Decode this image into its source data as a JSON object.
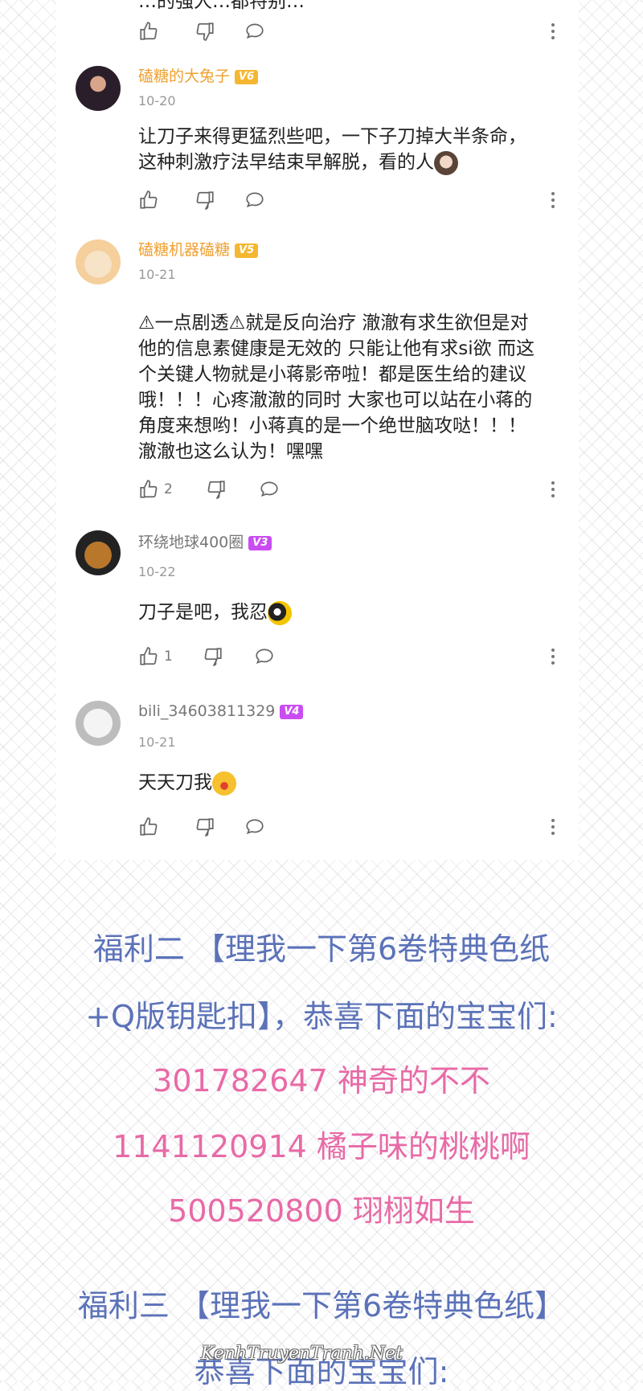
{
  "partial_top_text": "…的强人…都特别…",
  "comments": [
    {
      "username": "磕糖的大兔子",
      "level": "V6",
      "date": "10-20",
      "text": "让刀子来得更猛烈些吧，一下子刀掉大半条命，这种刺激疗法早结束早解脱，看的人",
      "likes": ""
    },
    {
      "username": "磕糖机器磕糖",
      "level": "V5",
      "date": "10-21",
      "text": "⚠一点剧透⚠就是反向治疗 澈澈有求生欲但是对他的信息素健康是无效的 只能让他有求si欲 而这个关键人物就是小蒋影帝啦！都是医生给的建议哦！！！心疼澈澈的同时 大家也可以站在小蒋的角度来想哟！小蒋真的是一个绝世脑攻哒！！！澈澈也这么认为！嘿嘿",
      "likes": "2"
    },
    {
      "username": "环绕地球400圈",
      "level": "V3",
      "date": "10-22",
      "text": "刀子是吧，我忍",
      "likes": "1"
    },
    {
      "username": "bili_34603811329",
      "level": "V4",
      "date": "10-21",
      "text": "天天刀我",
      "likes": ""
    }
  ],
  "colors": {
    "badge_orange": "#f5b732",
    "badge_purple": "#c94df2",
    "blue_text": "#5b72b8",
    "pink_text": "#e86aa6"
  },
  "announcement": {
    "line1": "福利二 【理我一下第6卷特典色纸",
    "line2": "+Q版钥匙扣】，恭喜下面的宝宝们:",
    "winners": [
      "301782647   神奇的不不",
      "1141120914  橘子味的桃桃啊",
      "500520800   珝栩如生"
    ],
    "line3": "福利三 【理我一下第6卷特典色纸】",
    "line4": "恭喜下面的宝宝们:"
  },
  "watermark": "KenhTruyenTranh.Net"
}
